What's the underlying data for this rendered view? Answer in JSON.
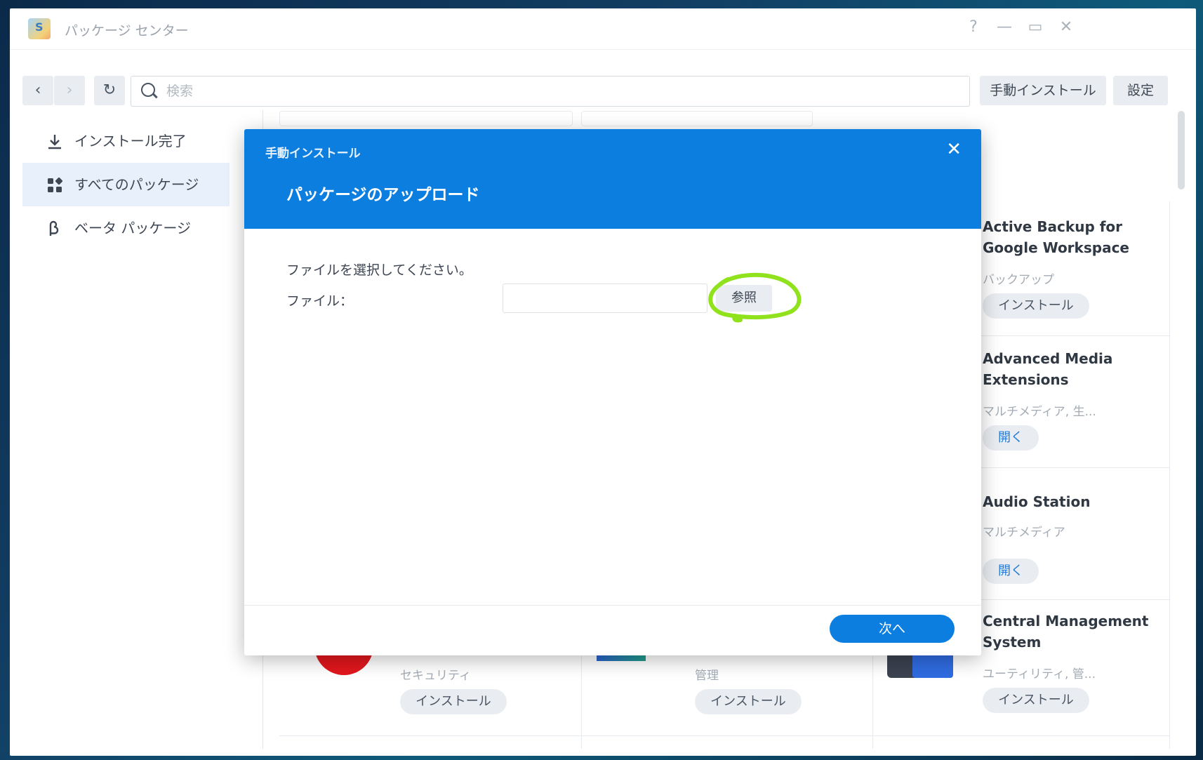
{
  "window": {
    "title": "パッケージ センター",
    "controls": {
      "help": "?",
      "minimize": "—",
      "maximize": "▭",
      "close": "✕"
    }
  },
  "toolbar": {
    "back_icon": "‹",
    "forward_icon": "›",
    "refresh_icon": "↻",
    "search_placeholder": "検索",
    "manual_install_label": "手動インストール",
    "settings_label": "設定"
  },
  "sidebar": {
    "items": [
      {
        "label": "インストール完了",
        "icon": "download-icon"
      },
      {
        "label": "すべてのパッケージ",
        "icon": "grid-icon",
        "active": true
      },
      {
        "label": "ベータ パッケージ",
        "icon": "beta-icon"
      }
    ]
  },
  "packages": [
    {
      "title": "Active Backup for Google Workspace",
      "category": "バックアップ",
      "action": "インストール"
    },
    {
      "title": "Advanced Media Extensions",
      "category": "マルチメディア, 生...",
      "action": "開く"
    },
    {
      "title": "Audio Station",
      "category": "マルチメディア",
      "action": "開く"
    },
    {
      "title": "Central Management System",
      "category": "ユーティリティ, 管...",
      "action": "インストール"
    },
    {
      "title": "",
      "category": "セキュリティ",
      "action": "インストール"
    },
    {
      "title": "",
      "category": "管理",
      "action": "インストール"
    }
  ],
  "modal": {
    "header_small": "手動インストール",
    "close_icon": "✕",
    "title": "パッケージのアップロード",
    "instruction": "ファイルを選択してください。",
    "file_label": "ファイル：",
    "browse_label": "参照",
    "next_label": "次へ"
  },
  "colors": {
    "accent": "#0b7ee0",
    "annotation": "#8fe21c"
  }
}
